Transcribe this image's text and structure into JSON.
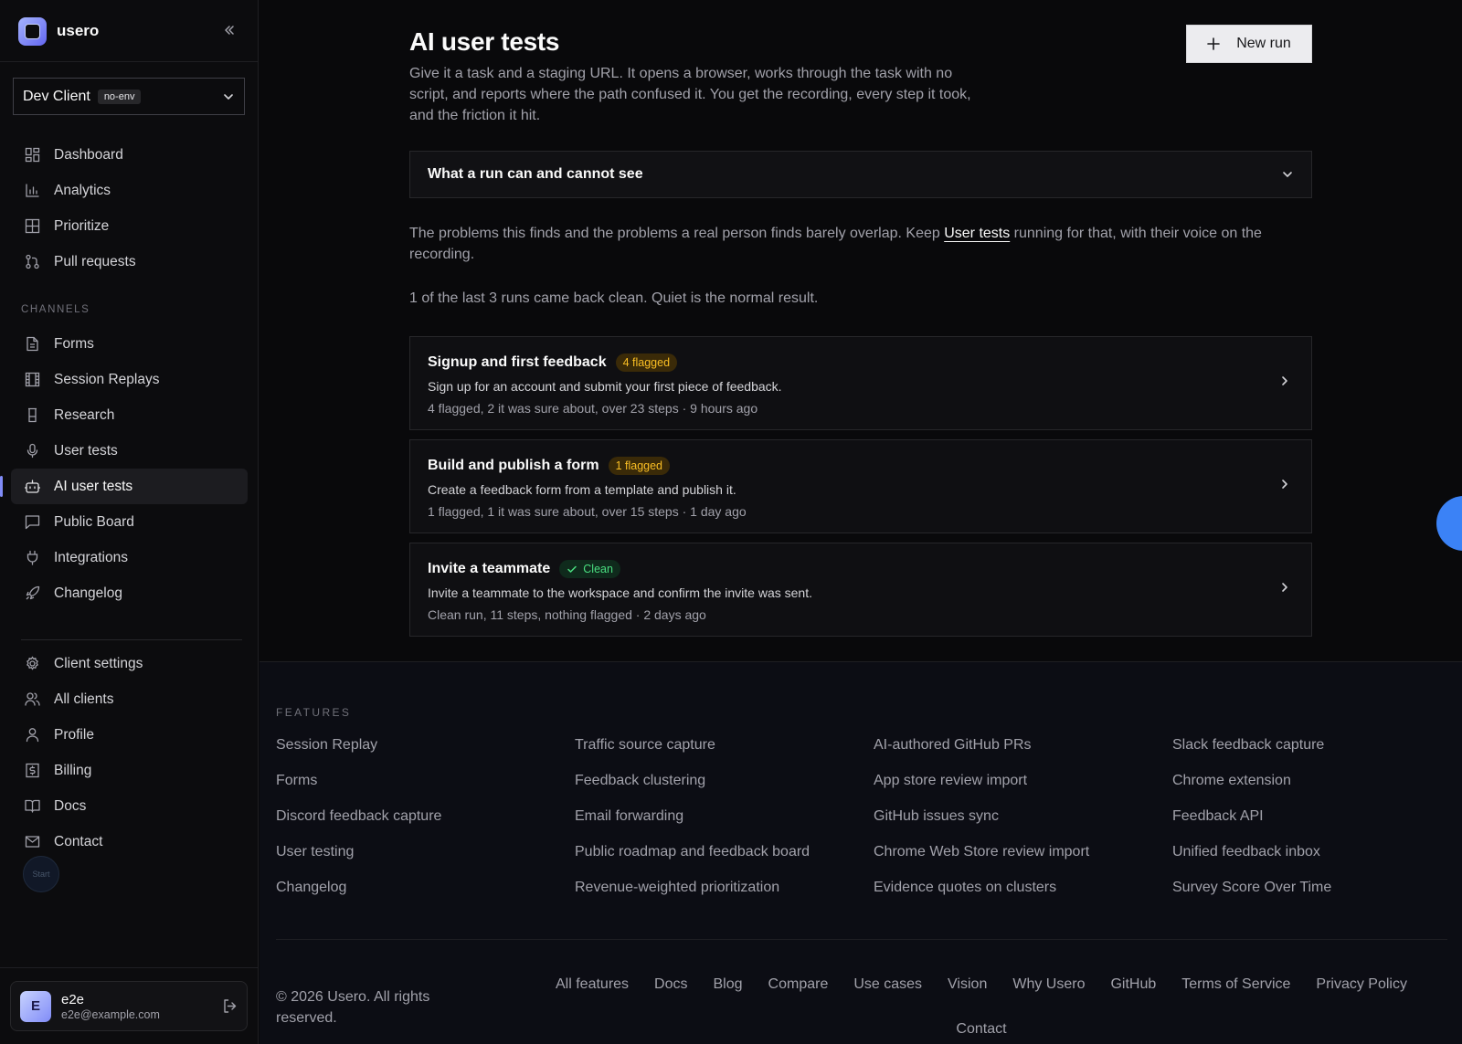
{
  "brand": {
    "name": "usero"
  },
  "client": {
    "name": "Dev Client",
    "env": "no-env"
  },
  "nav": {
    "primary": [
      {
        "label": "Dashboard",
        "icon": "dashboard-icon"
      },
      {
        "label": "Analytics",
        "icon": "bar-chart-icon"
      },
      {
        "label": "Prioritize",
        "icon": "grid-icon"
      },
      {
        "label": "Pull requests",
        "icon": "git-pull-request-icon"
      }
    ],
    "channels_label": "CHANNELS",
    "channels": [
      {
        "label": "Forms",
        "icon": "file-text-icon"
      },
      {
        "label": "Session Replays",
        "icon": "film-icon"
      },
      {
        "label": "Research",
        "icon": "flask-icon"
      },
      {
        "label": "User tests",
        "icon": "microphone-icon"
      },
      {
        "label": "AI user tests",
        "icon": "bot-icon",
        "active": true
      },
      {
        "label": "Public Board",
        "icon": "message-square-icon"
      },
      {
        "label": "Integrations",
        "icon": "plug-icon"
      },
      {
        "label": "Changelog",
        "icon": "rocket-icon"
      }
    ],
    "secondary": [
      {
        "label": "Client settings",
        "icon": "gear-icon"
      },
      {
        "label": "All clients",
        "icon": "users-icon"
      },
      {
        "label": "Profile",
        "icon": "user-icon"
      },
      {
        "label": "Billing",
        "icon": "dollar-receipt-icon"
      },
      {
        "label": "Docs",
        "icon": "book-open-icon"
      },
      {
        "label": "Contact",
        "icon": "mail-icon"
      }
    ],
    "start_label": "Start"
  },
  "user": {
    "initial": "E",
    "name": "e2e",
    "email": "e2e@example.com"
  },
  "page": {
    "title": "AI user tests",
    "description": "Give it a task and a staging URL. It opens a browser, works through the task with no script, and reports where the path confused it. You get the recording, every step it took, and the friction it hit.",
    "new_run_label": "New run",
    "accordion_title": "What a run can and cannot see",
    "note_before": "The problems this finds and the problems a real person finds barely overlap. Keep ",
    "note_link": "User tests",
    "note_after": " running for that, with their voice on the recording.",
    "summary": "1 of the last 3 runs came back clean. Quiet is the normal result."
  },
  "runs": [
    {
      "title": "Signup and first feedback",
      "badge": "4 flagged",
      "status": "flagged",
      "description": "Sign up for an account and submit your first piece of feedback.",
      "meta": "4 flagged, 2 it was sure about, over 23 steps · 9 hours ago"
    },
    {
      "title": "Build and publish a form",
      "badge": "1 flagged",
      "status": "flagged",
      "description": "Create a feedback form from a template and publish it.",
      "meta": "1 flagged, 1 it was sure about, over 15 steps · 1 day ago"
    },
    {
      "title": "Invite a teammate",
      "badge": "Clean",
      "status": "clean",
      "description": "Invite a teammate to the workspace and confirm the invite was sent.",
      "meta": "Clean run, 11 steps, nothing flagged · 2 days ago"
    }
  ],
  "footer": {
    "features_label": "FEATURES",
    "columns": [
      [
        "Session Replay",
        "Forms",
        "Discord feedback capture",
        "User testing",
        "Changelog"
      ],
      [
        "Traffic source capture",
        "Feedback clustering",
        "Email forwarding",
        "Public roadmap and feedback board",
        "Revenue-weighted prioritization"
      ],
      [
        "AI-authored GitHub PRs",
        "App store review import",
        "GitHub issues sync",
        "Chrome Web Store review import",
        "Evidence quotes on clusters"
      ],
      [
        "Slack feedback capture",
        "Chrome extension",
        "Feedback API",
        "Unified feedback inbox",
        "Survey Score Over Time"
      ]
    ],
    "copyright": "© 2026 Usero. All rights reserved.",
    "links": [
      "All features",
      "Docs",
      "Blog",
      "Compare",
      "Use cases",
      "Vision",
      "Why Usero",
      "GitHub",
      "Terms of Service",
      "Privacy Policy",
      "Contact"
    ]
  },
  "colors": {
    "accent": "#818cf8",
    "flag": "#fbbf24",
    "clean": "#4ade80",
    "fab": "#3b82f6"
  }
}
